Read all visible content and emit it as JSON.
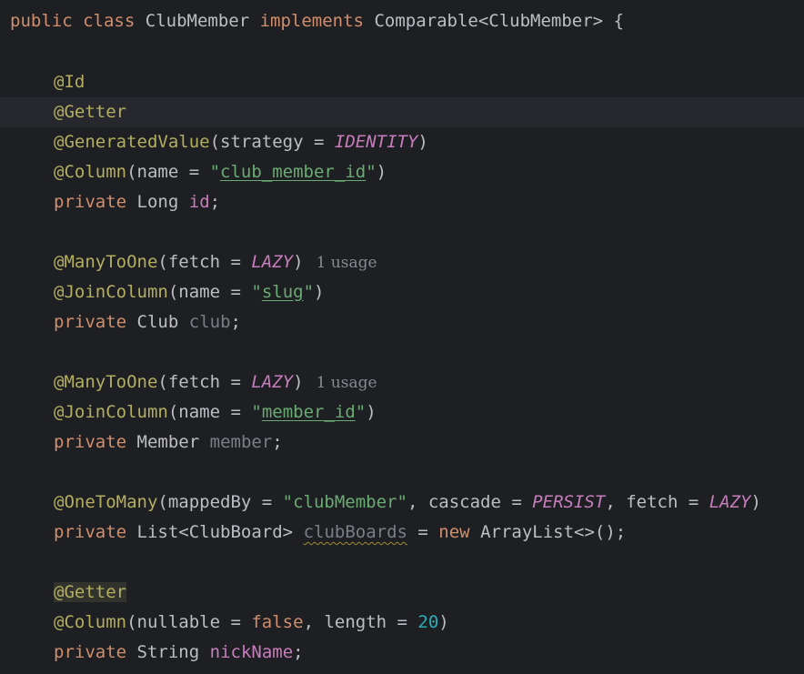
{
  "lines": {
    "l1": {
      "kw1": "public",
      "kw2": "class",
      "name": "ClubMember",
      "kw3": "implements",
      "iface": "Comparable<ClubMember>",
      "brace": "{"
    },
    "l3": {
      "ann": "@Id"
    },
    "l4": {
      "ann": "@Getter"
    },
    "l5": {
      "ann": "@GeneratedValue",
      "open": "(strategy = ",
      "val": "IDENTITY",
      "close": ")"
    },
    "l6": {
      "ann": "@Column",
      "open": "(name = ",
      "q1": "\"",
      "val": "club_member_id",
      "q2": "\"",
      "close": ")"
    },
    "l7": {
      "kw": "private",
      "type": "Long",
      "field": "id",
      "semi": ";"
    },
    "l9": {
      "ann": "@ManyToOne",
      "open": "(fetch = ",
      "val": "LAZY",
      "close": ")",
      "hint": "1 usage"
    },
    "l10": {
      "ann": "@JoinColumn",
      "open": "(name = ",
      "q1": "\"",
      "val": "slug",
      "q2": "\"",
      "close": ")"
    },
    "l11": {
      "kw": "private",
      "type": "Club",
      "field": "club",
      "semi": ";"
    },
    "l13": {
      "ann": "@ManyToOne",
      "open": "(fetch = ",
      "val": "LAZY",
      "close": ")",
      "hint": "1 usage"
    },
    "l14": {
      "ann": "@JoinColumn",
      "open": "(name = ",
      "q1": "\"",
      "val": "member_id",
      "q2": "\"",
      "close": ")"
    },
    "l15": {
      "kw": "private",
      "type": "Member",
      "field": "member",
      "semi": ";"
    },
    "l17": {
      "ann": "@OneToMany",
      "p1": "(mappedBy = ",
      "s1": "\"clubMember\"",
      "p2": ", cascade = ",
      "c1": "PERSIST",
      "p3": ", fetch = ",
      "c2": "LAZY",
      "p4": ")"
    },
    "l18": {
      "kw": "private",
      "type": "List<ClubBoard>",
      "field": "clubBoards",
      "eq": " = ",
      "kwnew": "new",
      "rest": " ArrayList<>();"
    },
    "l20": {
      "ann": "@Getter"
    },
    "l21": {
      "ann": "@Column",
      "p1": "(nullable = ",
      "kwfalse": "false",
      "p2": ", length = ",
      "num": "20",
      "p3": ")"
    },
    "l22": {
      "kw": "private",
      "type": "String",
      "field": "nickName",
      "semi": ";"
    }
  }
}
